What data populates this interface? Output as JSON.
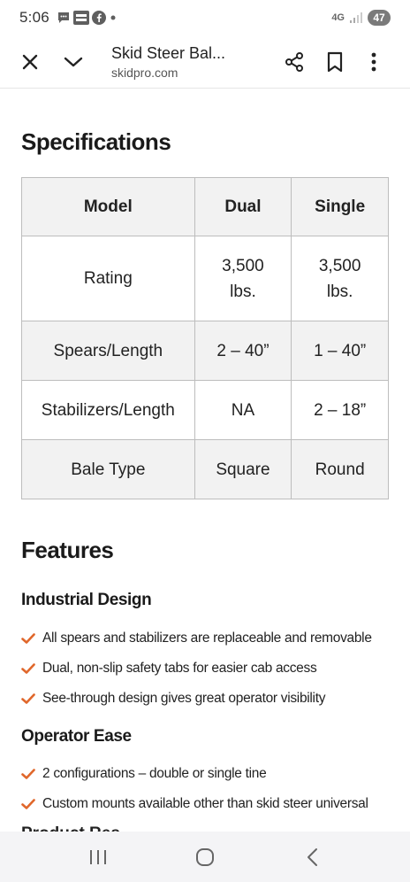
{
  "status_bar": {
    "time": "5:06",
    "network": "4G",
    "battery": "47",
    "icons": [
      "chat-icon",
      "fox-news-icon",
      "facebook-icon",
      "dot-icon"
    ]
  },
  "browser": {
    "title": "Skid Steer Bal...",
    "url": "skidpro.com"
  },
  "specs": {
    "heading": "Specifications",
    "headers": [
      "Model",
      "Dual",
      "Single"
    ],
    "rows": [
      [
        "Rating",
        "3,500 lbs.",
        "3,500 lbs."
      ],
      [
        "Spears/Length",
        "2 – 40”",
        "1 – 40”"
      ],
      [
        "Stabilizers/Length",
        "NA",
        "2 – 18”"
      ],
      [
        "Bale Type",
        "Square",
        "Round"
      ]
    ]
  },
  "features": {
    "heading": "Features",
    "sections": [
      {
        "title": "Industrial Design",
        "items": [
          "All spears and stabilizers are replaceable and removable",
          "Dual, non-slip safety tabs for easier cab access",
          "See-through design gives great operator visibility"
        ]
      },
      {
        "title": "Operator Ease",
        "items": [
          "2 configurations – double or single tine",
          "Custom mounts available other than skid steer universal"
        ]
      }
    ],
    "partial_heading": "Product Res"
  },
  "colors": {
    "accent_check": "#e0672b"
  }
}
